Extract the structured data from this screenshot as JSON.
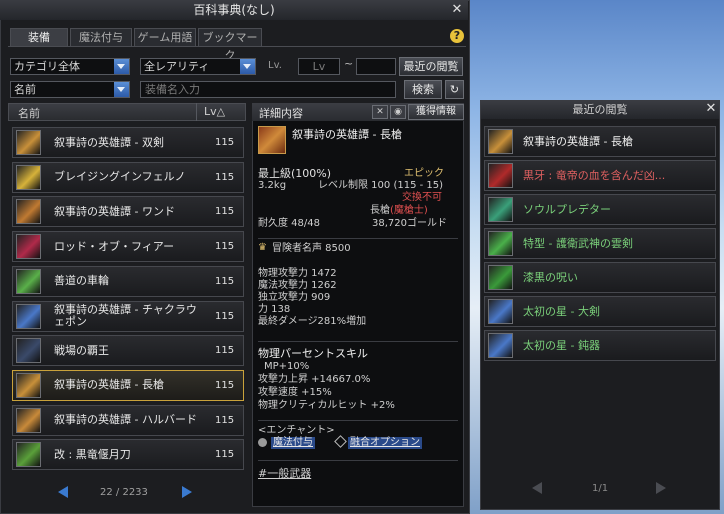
{
  "window": {
    "title": "百科事典(なし)"
  },
  "tabs": [
    "装備",
    "魔法付与",
    "ゲーム用語",
    "ブックマーク"
  ],
  "filters": {
    "category": "カテゴリ全体",
    "rarity": "全レアリティ",
    "lv_label": "Lv.",
    "lv_min": "Lv",
    "lv_sep": "~",
    "lv_max": "",
    "recent_button": "最近の閲覧",
    "sort": "名前",
    "name_placeholder": "装備名入力",
    "search_button": "検索"
  },
  "list": {
    "header_name": "名前",
    "header_lv": "Lv△",
    "items": [
      {
        "name": "叙事詩の英雄譚 - 双剣",
        "lv": "115",
        "icon_color": "#c8903a",
        "selected": false
      },
      {
        "name": "ブレイジングインフェルノ",
        "lv": "115",
        "icon_color": "#d6b23a",
        "selected": false
      },
      {
        "name": "叙事詩の英雄譚 - ワンド",
        "lv": "115",
        "icon_color": "#c07a32",
        "selected": false
      },
      {
        "name": "ロッド・オブ・フィアー",
        "lv": "115",
        "icon_color": "#b02a4a",
        "selected": false
      },
      {
        "name": "善道の車輪",
        "lv": "115",
        "icon_color": "#5ab04a",
        "selected": false
      },
      {
        "name": "叙事詩の英雄譚 - チャクラウェポン",
        "lv": "115",
        "icon_color": "#4a78c8",
        "selected": false
      },
      {
        "name": "戦場の覇王",
        "lv": "115",
        "icon_color": "#3a4a6a",
        "selected": false
      },
      {
        "name": "叙事詩の英雄譚 - 長槍",
        "lv": "115",
        "icon_color": "#c8903a",
        "selected": true
      },
      {
        "name": "叙事詩の英雄譚 - ハルバード",
        "lv": "115",
        "icon_color": "#c88a3a",
        "selected": false
      },
      {
        "name": "改 : 黒竜偃月刀",
        "lv": "115",
        "icon_color": "#5aa03a",
        "selected": false
      }
    ],
    "pager": "22 / 2233"
  },
  "detail": {
    "header": "詳細内容",
    "acquire_button": "獲得情報",
    "item_name": "叙事詩の英雄譚 - 長槍",
    "grade": "最上級(100%)",
    "rarity": "エピック",
    "weight": "3.2kg",
    "level_limit": "レベル制限 100 (115 - 15)",
    "trade": "交換不可",
    "type_prefix": "長槍",
    "type_class": "(魔槍士)",
    "durability": "耐久度 48/48",
    "price": "38,720ゴールド",
    "fame": "冒険者名声 8500",
    "stats": [
      "物理攻撃力 1472",
      "魔法攻撃力 1262",
      "独立攻撃力 909",
      "力 138",
      "最終ダメージ281%増加"
    ],
    "skill_title": "物理パーセントスキル",
    "skill_lines": [
      "MP+10%",
      "攻撃力上昇 +14667.0%",
      "攻撃速度 +15%",
      "物理クリティカルヒット +2%"
    ],
    "enchant_title": "<エンチャント>",
    "enchant_option1": "魔法付与",
    "enchant_option2": "融合オプション",
    "footer": "#一般武器"
  },
  "recent": {
    "title": "最近の閲覧",
    "items": [
      {
        "name": "叙事詩の英雄譚 - 長槍",
        "color": "#f0f0f0",
        "icon_color": "#c8903a"
      },
      {
        "name": "黒牙 : 竜帝の血を含んだ凶...",
        "color": "#e06060",
        "icon_color": "#b02a2a"
      },
      {
        "name": "ソウルプレデター",
        "color": "#7ad07a",
        "icon_color": "#3aa07a"
      },
      {
        "name": "特型 - 護衛武神の雲剣",
        "color": "#7ad07a",
        "icon_color": "#4ab04a"
      },
      {
        "name": "漆黒の呪い",
        "color": "#7ad07a",
        "icon_color": "#3a9a3a"
      },
      {
        "name": "太初の星 - 大剣",
        "color": "#7ad07a",
        "icon_color": "#4a78c8"
      },
      {
        "name": "太初の星 - 鈍器",
        "color": "#7ad07a",
        "icon_color": "#4a78c8"
      }
    ],
    "pager": "1/1"
  }
}
